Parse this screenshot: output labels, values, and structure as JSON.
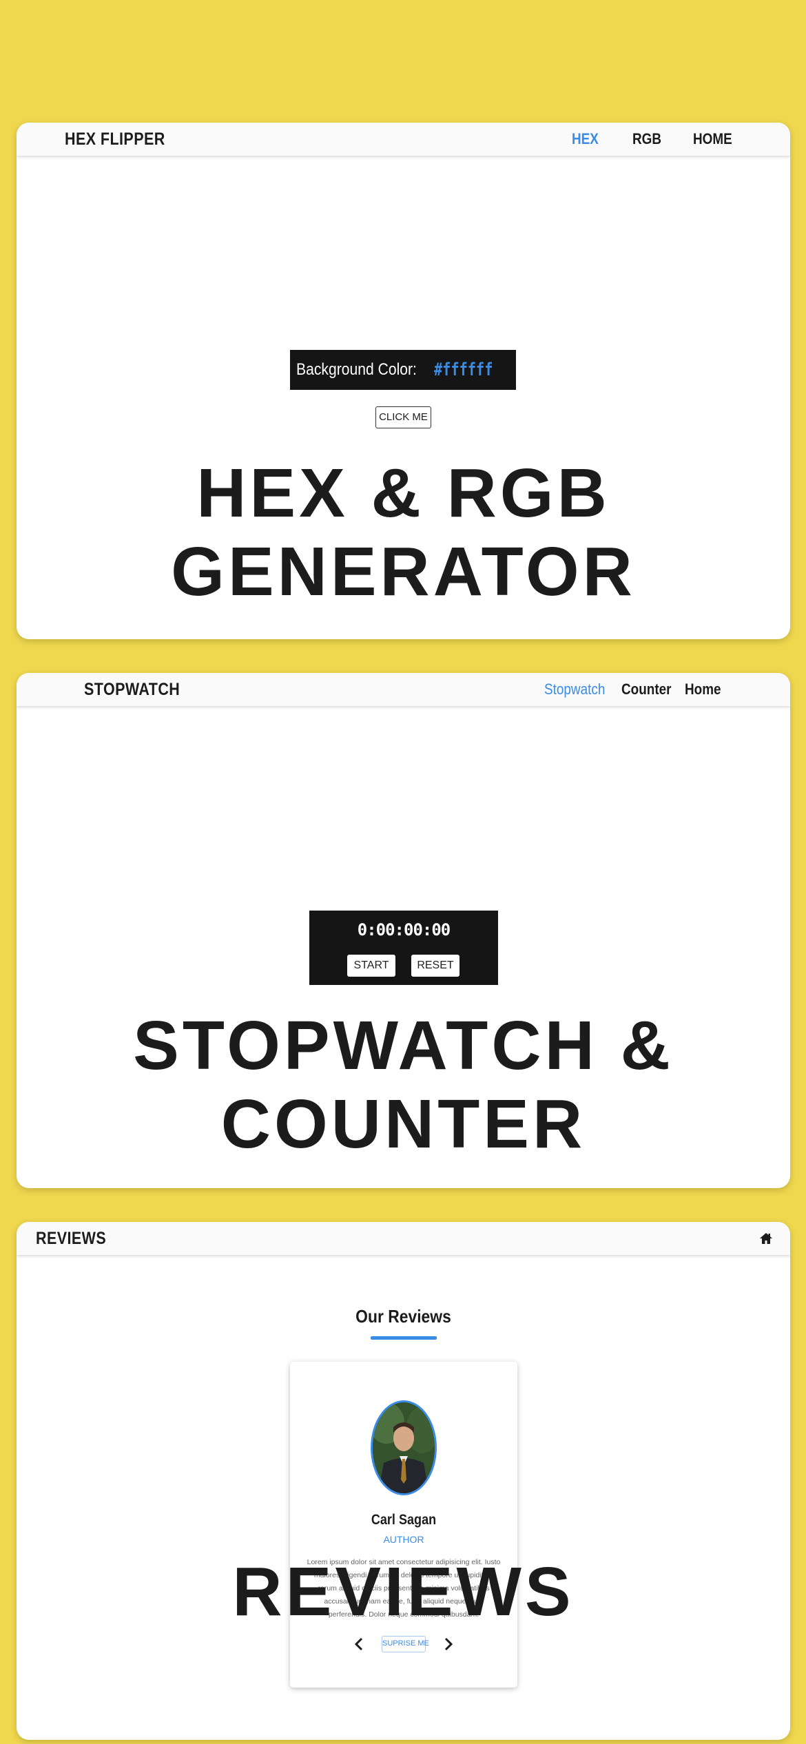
{
  "hex_card": {
    "brand": "HEX FLIPPER",
    "nav": [
      "HEX",
      "RGB",
      "HOME"
    ],
    "active_nav": "HEX",
    "bg_label": "Background Color:",
    "hex_value": "#ffffff",
    "button": "CLICK ME",
    "headline_1": "HEX & RGB",
    "headline_2": "GENERATOR"
  },
  "stopwatch_card": {
    "brand": "STOPWATCH",
    "nav": [
      "Stopwatch",
      "Counter",
      "Home"
    ],
    "active_nav": "Stopwatch",
    "time": "0:00:00:00",
    "start_button": "START",
    "reset_button": "RESET",
    "headline_1": "STOPWATCH &",
    "headline_2": "COUNTER"
  },
  "reviews_card": {
    "brand": "REVIEWS",
    "home_icon": "home-icon",
    "section_title": "Our Reviews",
    "person_name": "Carl Sagan",
    "person_role": "AUTHOR",
    "review_text": "Lorem ipsum dolor sit amet consectetur adipisicing elit. Iusto maiores eligendi harum ex deleniti tempore ut cupiditate rerum aliquid officiis praesentium minima voluptatibus accusantium nam eaque, fuga aliquid neque, quis perferendis. Dolor neque commodi quibusdam!",
    "prev_icon": "chevron-left-icon",
    "next_icon": "chevron-right-icon",
    "surprise_button": "SUPRISE ME",
    "headline": "REVIEWS"
  },
  "colors": {
    "page_background": "#efd74e",
    "accent": "#3b8ce6",
    "dark": "#151515"
  }
}
